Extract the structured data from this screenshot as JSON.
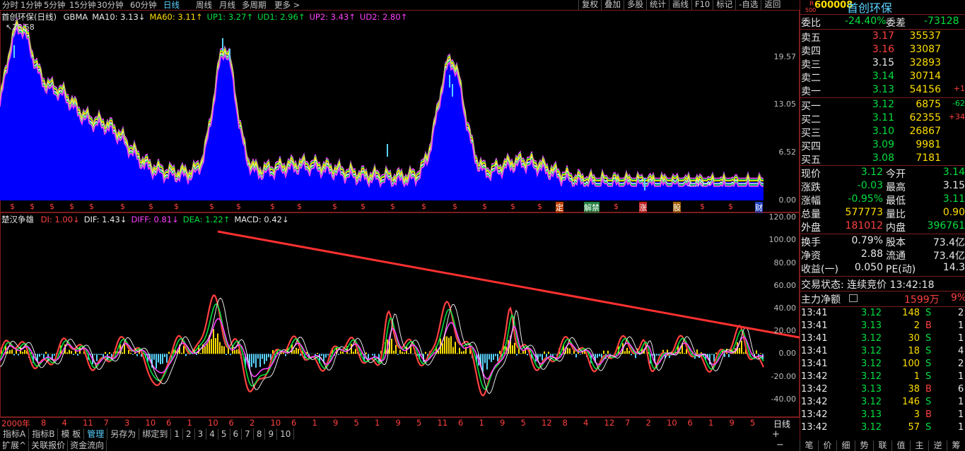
{
  "toolbar": {
    "periods": [
      "分时",
      "1分钟",
      "5分钟",
      "15分钟",
      "30分钟",
      "60分钟",
      "日线",
      "周线",
      "月线",
      "多周期",
      "更多 >"
    ],
    "active_period": "日线",
    "right_buttons": [
      "复权",
      "叠加",
      "多股",
      "统计",
      "画线",
      "F10",
      "标记",
      "-自选",
      "返回"
    ]
  },
  "main_chart": {
    "title": "首创环保(日线)",
    "indicators": [
      {
        "label": "GBMA",
        "color": "#e8e8e8"
      },
      {
        "label": "MA10: 3.13↓",
        "color": "#e8e8e8"
      },
      {
        "label": "MA60: 3.11↑",
        "color": "#ffdf00"
      },
      {
        "label": "UP1: 3.27↑",
        "color": "#00e040"
      },
      {
        "label": "UD1: 2.96↑",
        "color": "#00e040"
      },
      {
        "label": "UP2: 3.43↑",
        "color": "#ff40ff"
      },
      {
        "label": "UD2: 2.80↑",
        "color": "#ff40ff"
      }
    ],
    "max_label": "25.58",
    "min_label": "2.50",
    "y_ticks": [
      "19.57",
      "13.05",
      "6.52",
      "0.00"
    ],
    "ylim": [
      0,
      26
    ]
  },
  "event_markers": [
    "$",
    "定",
    "解禁",
    "$",
    "涨",
    "$",
    "财"
  ],
  "sub_chart": {
    "title": "楚汉争雄",
    "indicators": [
      {
        "label": "DI: 1.00↓",
        "color": "#ff4040"
      },
      {
        "label": "DIF: 1.43↓",
        "color": "#e8e8e8"
      },
      {
        "label": "DIFF: 0.81↓",
        "color": "#ff40ff"
      },
      {
        "label": "DEA: 1.22↑",
        "color": "#00e040"
      },
      {
        "label": "MACD: 0.42↓",
        "color": "#e8e8e8"
      }
    ],
    "y_ticks": [
      "120.00",
      "100.00",
      "80.00",
      "60.00",
      "40.00",
      "20.00",
      "0.00",
      "-20.00",
      "-40.00"
    ],
    "ylim": [
      -55,
      125
    ]
  },
  "x_axis": {
    "start": "2000年",
    "labels": [
      "8",
      "4",
      "11",
      "7",
      "3",
      "10",
      "6",
      "1",
      "10",
      "6",
      "2",
      "10",
      "6",
      "1",
      "9",
      "5",
      "1",
      "9",
      "5",
      "11",
      "6",
      "1",
      "9",
      "5",
      "12",
      "8",
      "4",
      "12",
      "7",
      "2",
      "10",
      "6",
      "1",
      "9",
      "5"
    ],
    "period_label": "日线"
  },
  "bottom_tabs": [
    "指标A",
    "指标B",
    "模 板",
    "管理",
    "另存为",
    "绑定到",
    "1",
    "2",
    "3",
    "4",
    "5",
    "6",
    "7",
    "8",
    "9",
    "10"
  ],
  "bottom_tabs_active": "管理",
  "bottom_tabs2": [
    "扩展^",
    "关联报价",
    "资金流向"
  ],
  "quote": {
    "code": "600008",
    "name": "首创环保",
    "wei_bi_label": "委比",
    "wei_bi": "-24.40%",
    "wei_cha_label": "委差",
    "wei_cha": "-73128",
    "asks": [
      {
        "label": "卖五",
        "price": "3.17",
        "vol": "35537",
        "chg": "",
        "pc": "red"
      },
      {
        "label": "卖四",
        "price": "3.16",
        "vol": "33087",
        "chg": "",
        "pc": "red"
      },
      {
        "label": "卖三",
        "price": "3.15",
        "vol": "32893",
        "chg": "",
        "pc": "wht"
      },
      {
        "label": "卖二",
        "price": "3.14",
        "vol": "30714",
        "chg": "",
        "pc": "green"
      },
      {
        "label": "卖一",
        "price": "3.13",
        "vol": "54156",
        "chg": "+1",
        "pc": "green"
      }
    ],
    "bids": [
      {
        "label": "买一",
        "price": "3.12",
        "vol": "6875",
        "chg": "-62",
        "pc": "green"
      },
      {
        "label": "买二",
        "price": "3.11",
        "vol": "62355",
        "chg": "+34",
        "pc": "green"
      },
      {
        "label": "买三",
        "price": "3.10",
        "vol": "26867",
        "chg": "",
        "pc": "green"
      },
      {
        "label": "买四",
        "price": "3.09",
        "vol": "9981",
        "chg": "",
        "pc": "green"
      },
      {
        "label": "买五",
        "price": "3.08",
        "vol": "7181",
        "chg": "",
        "pc": "green"
      }
    ],
    "stats": [
      {
        "l1": "现价",
        "v1": "3.12",
        "c1": "green",
        "l2": "今开",
        "v2": "3.14",
        "c2": "green"
      },
      {
        "l1": "涨跌",
        "v1": "-0.03",
        "c1": "green",
        "l2": "最高",
        "v2": "3.15",
        "c2": "wht"
      },
      {
        "l1": "涨幅",
        "v1": "-0.95%",
        "c1": "green",
        "l2": "最低",
        "v2": "3.11",
        "c2": "green"
      },
      {
        "l1": "总量",
        "v1": "577773",
        "c1": "yel",
        "l2": "量比",
        "v2": "0.90",
        "c2": "yel"
      },
      {
        "l1": "外盘",
        "v1": "181012",
        "c1": "red",
        "l2": "内盘",
        "v2": "396761",
        "c2": "green"
      }
    ],
    "stats2": [
      {
        "l1": "换手",
        "v1": "0.79%",
        "l2": "股本",
        "v2": "73.4亿"
      },
      {
        "l1": "净资",
        "v1": "2.88",
        "l2": "流通",
        "v2": "73.4亿"
      },
      {
        "l1": "收益(一)",
        "v1": "0.050",
        "l2": "PE(动)",
        "v2": "14.3"
      }
    ],
    "trade_status": "交易状态: 连续竞价 13:42:18",
    "main_net_label": "主力净额",
    "main_net_value": "1599万",
    "main_net_pct": "9%",
    "ticks": [
      {
        "time": "13:41",
        "price": "3.12",
        "vol": "148",
        "side": "S",
        "n": "2",
        "pc": "green"
      },
      {
        "time": "13:41",
        "price": "3.13",
        "vol": "2",
        "side": "B",
        "n": "1",
        "pc": "green"
      },
      {
        "time": "13:41",
        "price": "3.12",
        "vol": "30",
        "side": "S",
        "n": "1",
        "pc": "green"
      },
      {
        "time": "13:41",
        "price": "3.12",
        "vol": "18",
        "side": "S",
        "n": "4",
        "pc": "green"
      },
      {
        "time": "13:41",
        "price": "3.12",
        "vol": "100",
        "side": "S",
        "n": "2",
        "pc": "green"
      },
      {
        "time": "13:42",
        "price": "3.12",
        "vol": "1",
        "side": "S",
        "n": "1",
        "pc": "green"
      },
      {
        "time": "13:42",
        "price": "3.13",
        "vol": "38",
        "side": "B",
        "n": "6",
        "pc": "green"
      },
      {
        "time": "13:42",
        "price": "3.12",
        "vol": "146",
        "side": "S",
        "n": "1",
        "pc": "green"
      },
      {
        "time": "13:42",
        "price": "3.13",
        "vol": "3",
        "side": "B",
        "n": "1",
        "pc": "green"
      },
      {
        "time": "13:42",
        "price": "3.12",
        "vol": "57",
        "side": "S",
        "n": "1",
        "pc": "green"
      }
    ],
    "bottom_tabs": [
      "笔",
      "价",
      "细",
      "势",
      "联",
      "值",
      "主",
      "逆",
      "筹"
    ]
  },
  "colors": {
    "frame": "#7a1c1c",
    "fill": "#0000ff",
    "up": "#ff4040",
    "down": "#00e040",
    "arrow": "#ff3030"
  }
}
